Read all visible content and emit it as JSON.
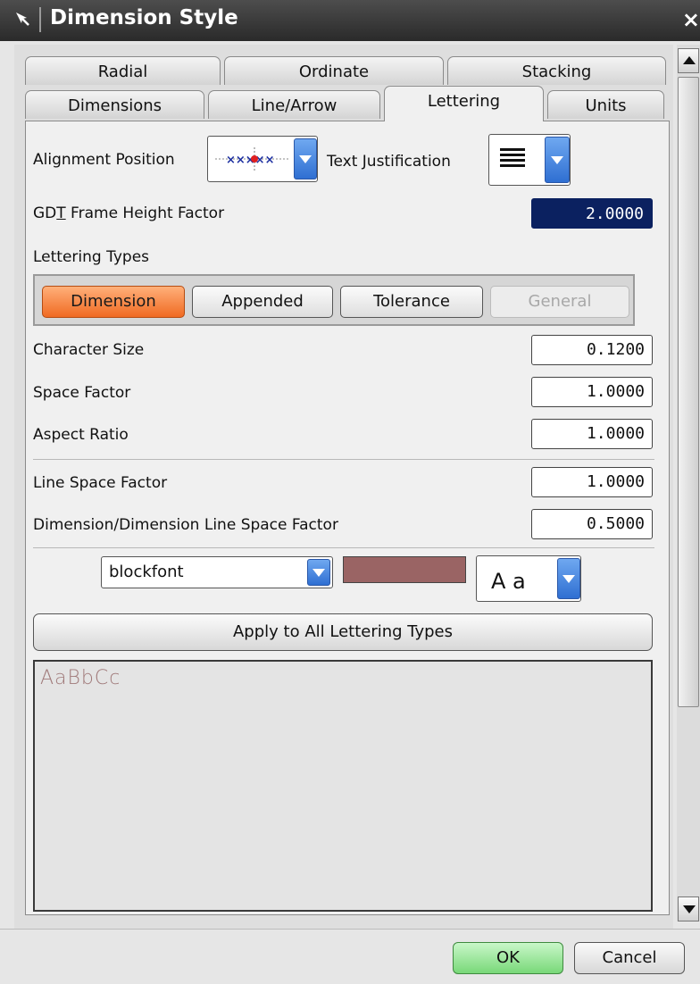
{
  "window": {
    "title": "Dimension Style",
    "close_glyph": "×"
  },
  "tabs": {
    "row1": [
      {
        "label": "Radial"
      },
      {
        "label": "Ordinate"
      },
      {
        "label": "Stacking"
      }
    ],
    "row2": [
      {
        "label": "Dimensions"
      },
      {
        "label": "Line/Arrow"
      },
      {
        "label": "Lettering",
        "active": true
      },
      {
        "label": "Units"
      }
    ]
  },
  "lettering": {
    "alignment_position_label": "Alignment Position",
    "text_justification_label": "Text Justification",
    "gdt_prefix": "GD",
    "gdt_underlined": "T",
    "gdt_suffix": " Frame Height Factor",
    "gdt_value": "2.0000",
    "lettering_types_label": "Lettering Types",
    "types": [
      {
        "label": "Dimension",
        "state": "selected"
      },
      {
        "label": "Appended",
        "state": "normal"
      },
      {
        "label": "Tolerance",
        "state": "normal"
      },
      {
        "label": "General",
        "state": "disabled"
      }
    ],
    "character_size_label": "Character Size",
    "character_size_value": "0.1200",
    "space_factor_label": "Space Factor",
    "space_factor_value": "1.0000",
    "aspect_ratio_label": "Aspect Ratio",
    "aspect_ratio_value": "1.0000",
    "line_space_factor_label": "Line Space Factor",
    "line_space_factor_value": "1.0000",
    "dim_line_space_factor_label": "Dimension/Dimension Line Space Factor",
    "dim_line_space_factor_value": "0.5000",
    "font_value": "blockfont",
    "color_swatch": "#9a6464",
    "style_value": "A a",
    "apply_label": "Apply to All Lettering Types",
    "preview_sample": "AaBbCc"
  },
  "footer": {
    "ok_label": "OK",
    "cancel_label": "Cancel"
  },
  "colors": {
    "selected_type": "#f06a22",
    "ok_button": "#78d878",
    "dropdown_arrow": "#2f6fd2",
    "selected_field": "#0b2160"
  }
}
